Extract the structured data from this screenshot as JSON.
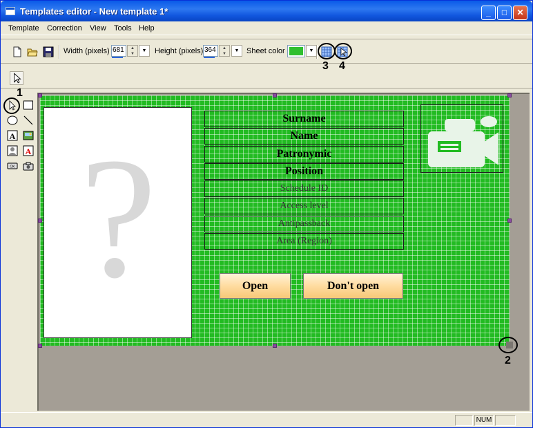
{
  "window": {
    "title": "Templates editor - New template 1*"
  },
  "menu": [
    "Template",
    "Correction",
    "View",
    "Tools",
    "Help"
  ],
  "toolbar": {
    "width_label": "Width (pixels)",
    "width_value": "681",
    "height_label": "Height (pixels)",
    "height_value": "364",
    "sheet_color_label": "Sheet color",
    "sheet_color": "#2fbf2f"
  },
  "annotations": {
    "n1": "1",
    "n2": "2",
    "n3": "3",
    "n4": "4"
  },
  "template": {
    "fields": [
      "Surname",
      "Name",
      "Patronymic",
      "Position",
      "Schedule ID",
      "Access level",
      "Antipassback",
      "Area (Region)"
    ],
    "photo_placeholder": "?",
    "buttons": {
      "open": "Open",
      "dont_open": "Don't open"
    },
    "grid_color": "#22bb22"
  },
  "icons": {
    "new": "new-document-icon",
    "open": "open-folder-icon",
    "save": "save-disk-icon",
    "grid": "grid-icon",
    "snap": "snap-to-grid-icon",
    "pointer": "pointer-arrow-icon",
    "camera": "video-camera-icon"
  },
  "status": {
    "num": "NUM"
  }
}
